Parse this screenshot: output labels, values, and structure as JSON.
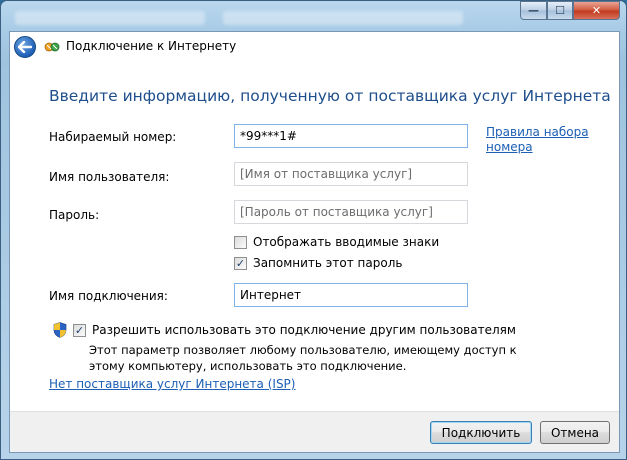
{
  "window": {
    "minimize_icon": "minimize-icon",
    "maximize_icon": "maximize-icon",
    "close_icon": "close-icon",
    "close_glyph": "✕",
    "minimize_glyph": "—",
    "maximize_glyph": "☐"
  },
  "header": {
    "back_icon": "back-arrow-icon",
    "app_icon": "network-connection-icon",
    "title": "Подключение к Интернету"
  },
  "main": {
    "heading": "Введите информацию, полученную от поставщика услуг Интернета",
    "dial_number": {
      "label": "Набираемый номер:",
      "value": "*99***1#"
    },
    "dialing_rules_link": {
      "line1": "Правила набора",
      "line2": "номера"
    },
    "username": {
      "label": "Имя пользователя:",
      "placeholder": "[Имя от поставщика услуг]"
    },
    "password": {
      "label": "Пароль:",
      "placeholder": "[Пароль от поставщика услуг]"
    },
    "show_chars": {
      "label": "Отображать вводимые знаки",
      "checked": false
    },
    "remember_password": {
      "label": "Запомнить этот пароль",
      "checked": true
    },
    "connection_name": {
      "label": "Имя подключения:",
      "value": "Интернет"
    },
    "allow_others": {
      "label": "Разрешить использовать это подключение другим пользователям",
      "checked": true,
      "shield_icon": "uac-shield-icon"
    },
    "allow_others_desc": "Этот параметр позволяет любому пользователю, имеющему доступ к этому компьютеру, использовать это подключение.",
    "no_isp_link": "Нет поставщика услуг Интернета (ISP)"
  },
  "footer": {
    "connect_label": "Подключить",
    "cancel_label": "Отмена"
  },
  "colors": {
    "heading": "#1e4e8c",
    "link": "#1c5fb4",
    "close_button": "#c0381c"
  }
}
